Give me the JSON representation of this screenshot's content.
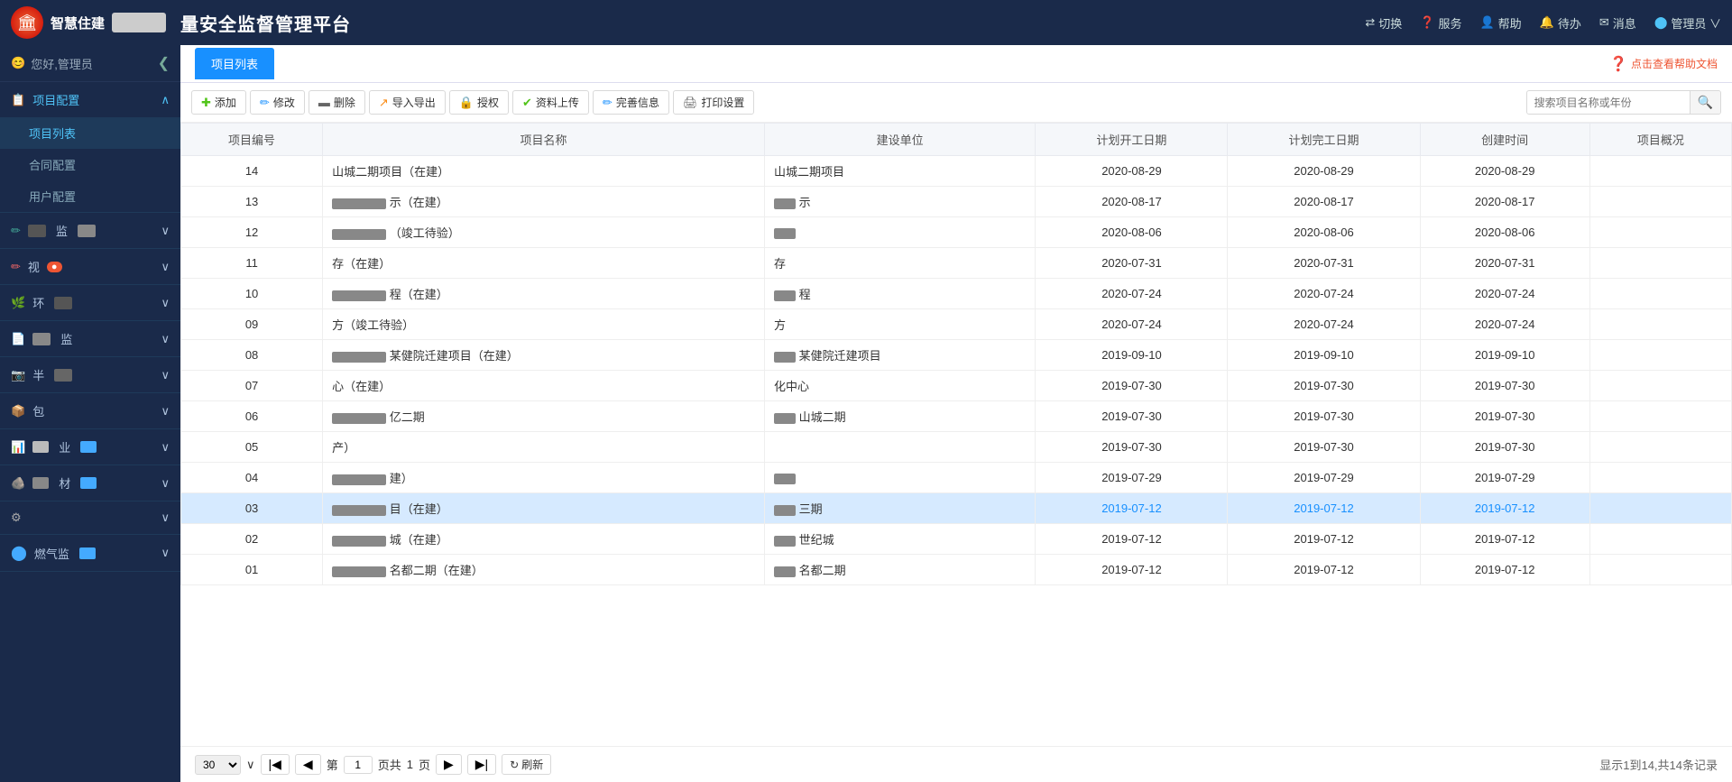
{
  "header": {
    "logo_char": "智",
    "logo_subtitle": "智慧住建",
    "app_title": "量安全监督管理平台",
    "actions": [
      {
        "icon": "⇄",
        "label": "切换"
      },
      {
        "icon": "●",
        "label": "服务"
      },
      {
        "icon": "👤",
        "label": "帮助"
      },
      {
        "icon": "🔔",
        "label": "待办"
      },
      {
        "icon": "✉",
        "label": "消息"
      },
      {
        "icon": "👤",
        "label": "管理员 ∨"
      }
    ]
  },
  "user": {
    "greeting": "您好,管理员"
  },
  "sidebar": {
    "collapse_icon": "❮",
    "groups": [
      {
        "id": "project-config",
        "label": "项目配置",
        "icon": "📋",
        "expanded": true,
        "items": [
          {
            "id": "project-list",
            "label": "项目列表",
            "active": true
          },
          {
            "id": "contract-config",
            "label": "合同配置"
          },
          {
            "id": "user-config",
            "label": "用户配置"
          }
        ]
      },
      {
        "id": "group2",
        "label": "监",
        "icon": "✏️",
        "expanded": false,
        "items": []
      },
      {
        "id": "group3",
        "label": "视",
        "icon": "👁",
        "expanded": false,
        "items": [],
        "badge": true
      },
      {
        "id": "group4",
        "label": "环",
        "icon": "🌿",
        "expanded": false,
        "items": []
      },
      {
        "id": "group5",
        "label": "监",
        "icon": "📄",
        "expanded": false,
        "items": []
      },
      {
        "id": "group6",
        "label": "半",
        "icon": "📷",
        "expanded": false,
        "items": []
      },
      {
        "id": "group7",
        "label": "包",
        "icon": "📦",
        "expanded": false,
        "items": []
      },
      {
        "id": "group8",
        "label": "业",
        "icon": "📊",
        "expanded": false,
        "items": []
      },
      {
        "id": "group9",
        "label": "材",
        "icon": "🪨",
        "expanded": false,
        "items": []
      },
      {
        "id": "group10",
        "label": "",
        "icon": "⚙",
        "expanded": false,
        "items": []
      },
      {
        "id": "group11",
        "label": "燃气监",
        "icon": "🔵",
        "expanded": false,
        "items": []
      }
    ]
  },
  "page": {
    "tab_label": "项目列表",
    "help_link": "点击查看帮助文档"
  },
  "toolbar": {
    "add": "添加",
    "edit": "修改",
    "delete": "删除",
    "import": "导入导出",
    "authorize": "授权",
    "upload": "资料上传",
    "complete": "完善信息",
    "print": "打印设置",
    "search_placeholder": "搜索项目名称或年份"
  },
  "table": {
    "columns": [
      "项目编号",
      "项目名称",
      "建设单位",
      "计划开工日期",
      "计划完工日期",
      "创建时间",
      "项目概况"
    ],
    "rows": [
      {
        "id": "14",
        "name": "山城二期项目（在建）",
        "name_blurred": false,
        "builder": "山城二期项目",
        "builder_blurred": false,
        "start": "2020-08-29",
        "end": "2020-08-29",
        "created": "2020-08-29",
        "selected": false
      },
      {
        "id": "13",
        "name": "示（在建）",
        "name_blurred": true,
        "builder": "示",
        "builder_blurred": true,
        "start": "2020-08-17",
        "end": "2020-08-17",
        "created": "2020-08-17",
        "selected": false
      },
      {
        "id": "12",
        "name": "（竣工待验）",
        "name_blurred": true,
        "builder": "",
        "builder_blurred": true,
        "start": "2020-08-06",
        "end": "2020-08-06",
        "created": "2020-08-06",
        "selected": false
      },
      {
        "id": "11",
        "name": "存（在建）",
        "name_blurred": false,
        "builder": "存",
        "builder_blurred": false,
        "start": "2020-07-31",
        "end": "2020-07-31",
        "created": "2020-07-31",
        "selected": false
      },
      {
        "id": "10",
        "name": "程（在建）",
        "name_blurred": true,
        "builder": "程",
        "builder_blurred": true,
        "start": "2020-07-24",
        "end": "2020-07-24",
        "created": "2020-07-24",
        "selected": false
      },
      {
        "id": "09",
        "name": "方（竣工待验）",
        "name_blurred": false,
        "builder": "方",
        "builder_blurred": false,
        "start": "2020-07-24",
        "end": "2020-07-24",
        "created": "2020-07-24",
        "selected": false
      },
      {
        "id": "08",
        "name": "某健院迁建项目（在建）",
        "name_blurred": true,
        "builder": "某健院迁建项目",
        "builder_blurred": true,
        "start": "2019-09-10",
        "end": "2019-09-10",
        "created": "2019-09-10",
        "selected": false
      },
      {
        "id": "07",
        "name": "心（在建）",
        "name_blurred": false,
        "builder": "化中心",
        "builder_blurred": false,
        "start": "2019-07-30",
        "end": "2019-07-30",
        "created": "2019-07-30",
        "selected": false
      },
      {
        "id": "06",
        "name": "亿二期",
        "name_blurred": true,
        "builder": "山城二期",
        "builder_blurred": true,
        "start": "2019-07-30",
        "end": "2019-07-30",
        "created": "2019-07-30",
        "selected": false
      },
      {
        "id": "05",
        "name": "产）",
        "name_blurred": false,
        "builder": "",
        "builder_blurred": false,
        "start": "2019-07-30",
        "end": "2019-07-30",
        "created": "2019-07-30",
        "selected": false
      },
      {
        "id": "04",
        "name": "建）",
        "name_blurred": true,
        "builder": "",
        "builder_blurred": true,
        "start": "2019-07-29",
        "end": "2019-07-29",
        "created": "2019-07-29",
        "selected": false
      },
      {
        "id": "03",
        "name": "目（在建）",
        "name_blurred": true,
        "builder": "三期",
        "builder_blurred": true,
        "start": "2019-07-12",
        "end": "2019-07-12",
        "created": "2019-07-12",
        "selected": true
      },
      {
        "id": "02",
        "name": "城（在建）",
        "name_blurred": true,
        "builder": "世纪城",
        "builder_blurred": true,
        "start": "2019-07-12",
        "end": "2019-07-12",
        "created": "2019-07-12",
        "selected": false
      },
      {
        "id": "01",
        "name": "名都二期（在建）",
        "name_blurred": true,
        "builder": "名都二期",
        "builder_blurred": true,
        "start": "2019-07-12",
        "end": "2019-07-12",
        "created": "2019-07-12",
        "selected": false
      }
    ]
  },
  "pagination": {
    "page_size": "30",
    "current_page": "1",
    "total_pages": "1",
    "page_label": "页共",
    "pages_label": "页",
    "refresh_label": "刷新",
    "info": "显示1到14,共14条记录"
  }
}
